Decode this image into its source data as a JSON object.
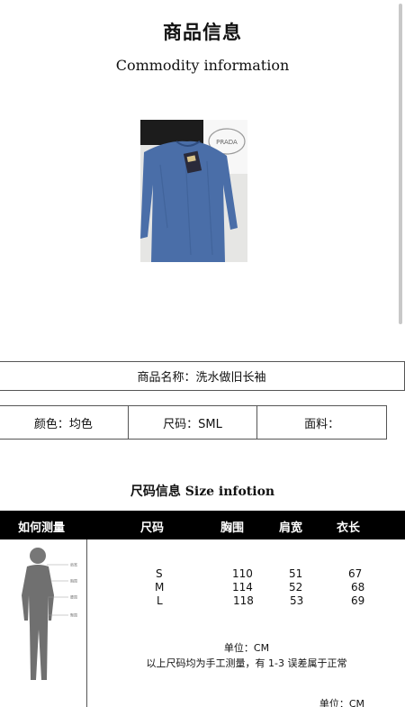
{
  "header": {
    "title": "商品信息",
    "subtitle": "Commodity information"
  },
  "product": {
    "name_line": "商品名称：洗水做旧长袖",
    "attributes": [
      "颜色：均色",
      "尺码：SML",
      "面料："
    ],
    "photo_brand_mark": "PRADA"
  },
  "size_section": {
    "title": "尺码信息 Size infotion",
    "headers": [
      "如何测量",
      "尺码",
      "胸围",
      "肩宽",
      "衣长"
    ],
    "rows": [
      {
        "size": "S",
        "chest": "110",
        "shoulder": "51",
        "length": "67"
      },
      {
        "size": "M",
        "chest": "114",
        "shoulder": "52",
        "length": "68"
      },
      {
        "size": "L",
        "chest": "118",
        "shoulder": "53",
        "length": "69"
      }
    ],
    "figure_labels": [
      "肩宽",
      "胸围",
      "腰围",
      "臀围"
    ],
    "unit_note": "单位：CM",
    "error_note": "以上尺码均为手工测量，有 1-3 误差属于正常",
    "footer_unit": "单位：CM"
  },
  "colors": {
    "header_bg": "#000000",
    "sweater_blue": "#4a6ea8"
  }
}
